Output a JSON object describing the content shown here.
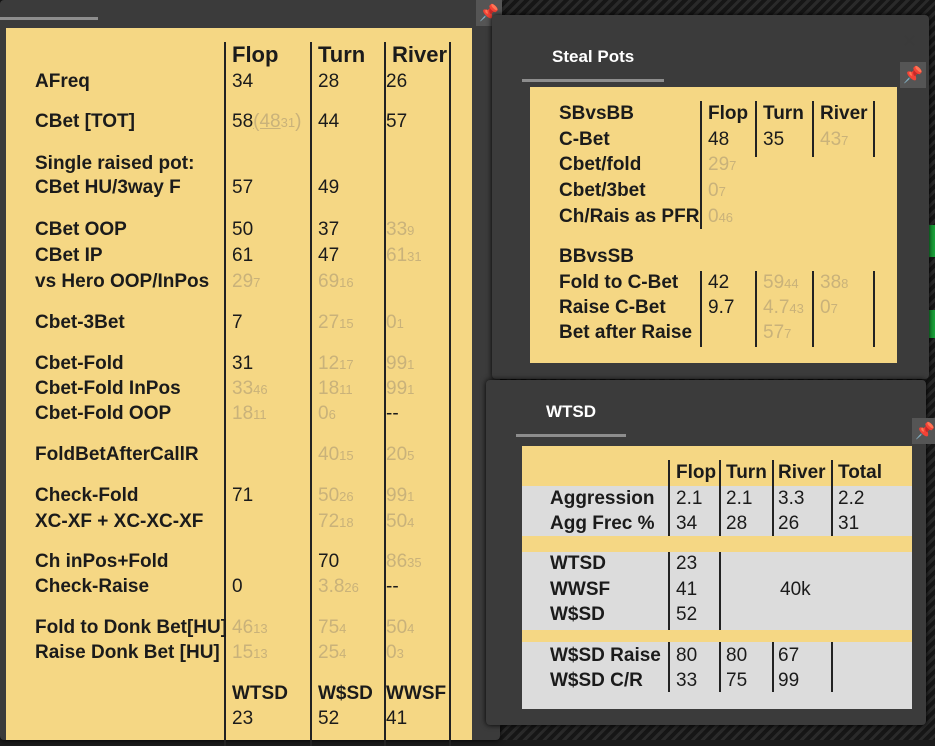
{
  "main": {
    "headers": [
      "Flop",
      "Turn",
      "River"
    ],
    "rows": [
      {
        "label": "AFreq",
        "flop": "34",
        "turn": "28",
        "river": "26"
      },
      {
        "label": "CBet [TOT]",
        "flop": "58",
        "flop_paren": "(48",
        "flop_sub": "31",
        ")": ")",
        "turn": "44",
        "river": "57"
      },
      {
        "label": "Single raised pot:"
      },
      {
        "label": "CBet HU/3way F",
        "flop": "57",
        "turn": "49"
      },
      {
        "label": "CBet OOP",
        "flop": "50",
        "turn": "37",
        "river": "33",
        "river_sub": "9"
      },
      {
        "label": "CBet IP",
        "flop": "61",
        "turn": "47",
        "river": "61",
        "river_sub": "31"
      },
      {
        "label": "vs Hero OOP/InPos",
        "flop": "29",
        "flop_sub": "7",
        "turn": "69",
        "turn_sub": "16"
      },
      {
        "label": "Cbet-3Bet",
        "flop": "7",
        "turn": "27",
        "turn_sub": "15",
        "river": "0",
        "river_sub": "1"
      },
      {
        "label": "Cbet-Fold",
        "flop": "31",
        "turn": "12",
        "turn_sub": "17",
        "river": "99",
        "river_sub": "1"
      },
      {
        "label": "Cbet-Fold InPos",
        "flop": "33",
        "flop_sub": "46",
        "turn": "18",
        "turn_sub": "11",
        "river": "99",
        "river_sub": "1"
      },
      {
        "label": "Cbet-Fold OOP",
        "flop": "18",
        "flop_sub": "11",
        "turn": "0",
        "turn_sub": "6",
        "river": "--"
      },
      {
        "label": "FoldBetAfterCallR",
        "turn": "40",
        "turn_sub": "15",
        "river": "20",
        "river_sub": "5"
      },
      {
        "label": "Check-Fold",
        "flop": "71",
        "turn": "50",
        "turn_sub": "26",
        "river": "99",
        "river_sub": "1"
      },
      {
        "label": "XC-XF + XC-XC-XF",
        "turn": "72",
        "turn_sub": "18",
        "river": "50",
        "river_sub": "4"
      },
      {
        "label": "Ch inPos+Fold",
        "turn": "70",
        "river": "86",
        "river_sub": "35"
      },
      {
        "label": "Check-Raise",
        "flop": "0",
        "turn": "3.8",
        "turn_sub": "26",
        "river": "--"
      },
      {
        "label": "Fold to Donk Bet[HU]",
        "flop": "46",
        "flop_sub": "13",
        "turn": "75",
        "turn_sub": "4",
        "river": "50",
        "river_sub": "4"
      },
      {
        "label": "Raise Donk Bet [HU]",
        "flop": "15",
        "flop_sub": "13",
        "turn": "25",
        "turn_sub": "4",
        "river": "0",
        "river_sub": "3"
      }
    ],
    "footer_headers": [
      "WTSD",
      "W$SD",
      "WWSF"
    ],
    "footer_values": [
      "23",
      "52",
      "41"
    ]
  },
  "steal": {
    "tab": "Steal Pots",
    "headers": [
      "Flop",
      "Turn",
      "River"
    ],
    "group1": "SBvsBB",
    "rows1": [
      {
        "label": "C-Bet",
        "flop": "48",
        "turn": "35",
        "river": "43",
        "river_sub": "7"
      },
      {
        "label": "Cbet/fold",
        "flop": "29",
        "flop_sub": "7"
      },
      {
        "label": "Cbet/3bet",
        "flop": "0",
        "flop_sub": "7"
      },
      {
        "label": "Ch/Rais as PFR",
        "flop": "0",
        "flop_sub": "46"
      }
    ],
    "group2": "BBvsSB",
    "rows2": [
      {
        "label": "Fold to C-Bet",
        "flop": "42",
        "turn": "59",
        "turn_sub": "44",
        "river": "38",
        "river_sub": "8"
      },
      {
        "label": "Raise C-Bet",
        "flop": "9.7",
        "turn": "4.7",
        "turn_sub": "43",
        "river": "0",
        "river_sub": "7"
      },
      {
        "label": "Bet after Raise",
        "turn": "57",
        "turn_sub": "7"
      }
    ]
  },
  "wtsd": {
    "tab": "WTSD",
    "headers": [
      "Flop",
      "Turn",
      "River",
      "Total"
    ],
    "rows_a": [
      {
        "label": "Aggression",
        "vals": [
          "2.1",
          "2.1",
          "3.3",
          "2.2"
        ]
      },
      {
        "label": "Agg Frec %",
        "vals": [
          "34",
          "28",
          "26",
          "31"
        ]
      }
    ],
    "rows_b": [
      {
        "label": "WTSD",
        "val": "23"
      },
      {
        "label": "WWSF",
        "val": "41"
      },
      {
        "label": "W$SD",
        "val": "52"
      }
    ],
    "hands": "40k",
    "rows_c": [
      {
        "label": "W$SD Raise",
        "vals": [
          "80",
          "80",
          "67"
        ]
      },
      {
        "label": "W$SD C/R",
        "vals": [
          "33",
          "75",
          "99"
        ]
      }
    ]
  },
  "icons": {
    "pin": "pin-icon",
    "close": "close-icon"
  },
  "colors": {
    "panel_bg": "#f5d784",
    "dim_text": "#c9b27a",
    "grey_band": "#dcdcdc"
  }
}
